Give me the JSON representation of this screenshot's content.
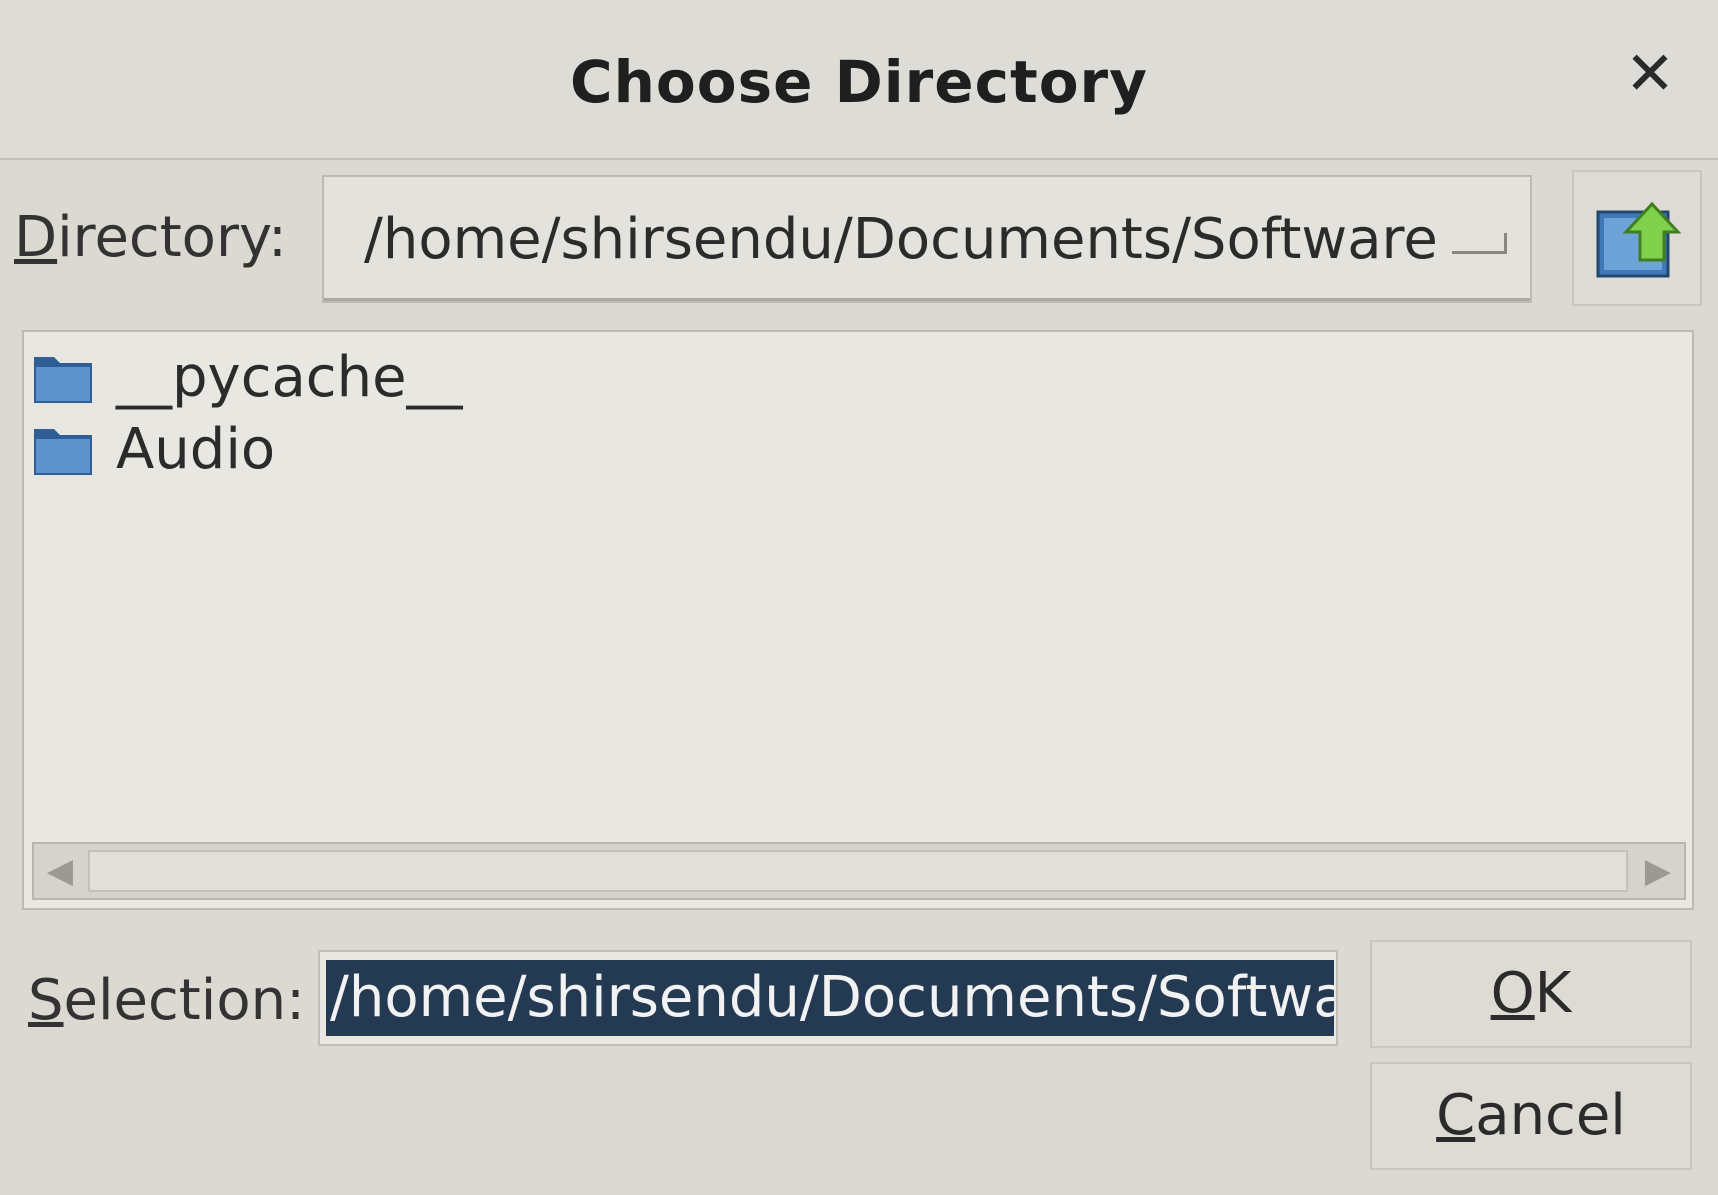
{
  "dialog": {
    "title": "Choose Directory",
    "close_symbol": "✕"
  },
  "directory": {
    "label_mnemonic": "D",
    "label_rest": "irectory:",
    "value": "/home/shirsendu/Documents/Software",
    "up_button_icon": "folder-up-icon"
  },
  "file_list": {
    "items": [
      {
        "name": "__pycache__",
        "icon": "folder-icon"
      },
      {
        "name": "Audio",
        "icon": "folder-icon"
      }
    ]
  },
  "selection": {
    "label_mnemonic": "S",
    "label_rest": "election:",
    "value": "/home/shirsendu/Documents/Software"
  },
  "buttons": {
    "ok_mnemonic": "O",
    "ok_rest": "K",
    "cancel_mnemonic": "C",
    "cancel_rest": "ancel"
  },
  "colors": {
    "selection_highlight": "#243a52",
    "folder_blue": "#3f79b8"
  }
}
